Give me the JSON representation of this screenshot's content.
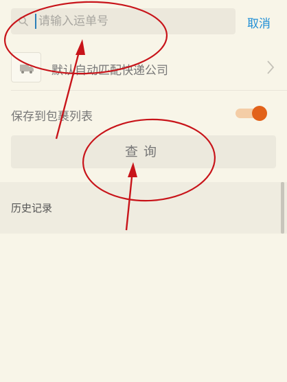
{
  "search": {
    "placeholder": "请输入运单号",
    "value": "",
    "cancel_label": "取消"
  },
  "courier": {
    "label": "默认自动匹配快递公司"
  },
  "save": {
    "label": "保存到包裹列表",
    "enabled": true
  },
  "query": {
    "label": "查询"
  },
  "history": {
    "label": "历史记录"
  },
  "colors": {
    "accent_blue": "#1f8ed6",
    "toggle_on": "#e2621a",
    "annotation_red": "#c8141a"
  },
  "icons": {
    "search": "search-icon",
    "courier": "courier-icon",
    "chevron": "chevron-right-icon"
  }
}
